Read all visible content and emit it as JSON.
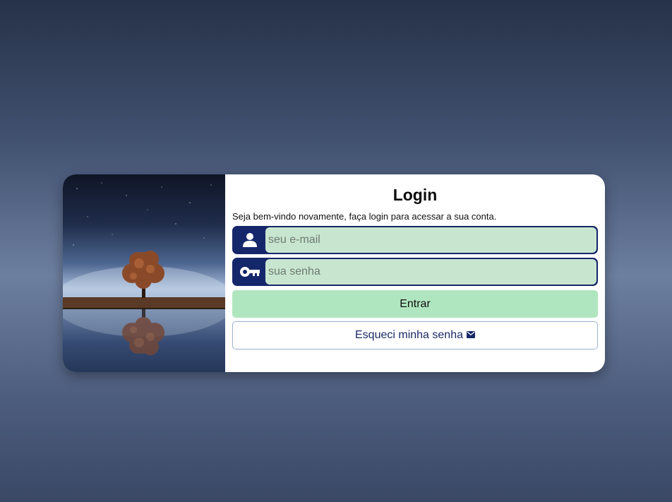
{
  "login": {
    "title": "Login",
    "subtitle": "Seja bem-vindo novamente, faça login para acessar a sua conta.",
    "email": {
      "placeholder": "seu e-mail",
      "value": "",
      "icon": "user-icon"
    },
    "password": {
      "placeholder": "sua senha",
      "value": "",
      "icon": "key-icon"
    },
    "submit_label": "Entrar",
    "forgot_label": "Esqueci minha senha",
    "forgot_icon": "envelope-icon"
  },
  "colors": {
    "field_border": "#15276b",
    "field_bg": "#c8e6cf",
    "submit_bg": "#b0e6bf",
    "forgot_text": "#1a2a66"
  }
}
